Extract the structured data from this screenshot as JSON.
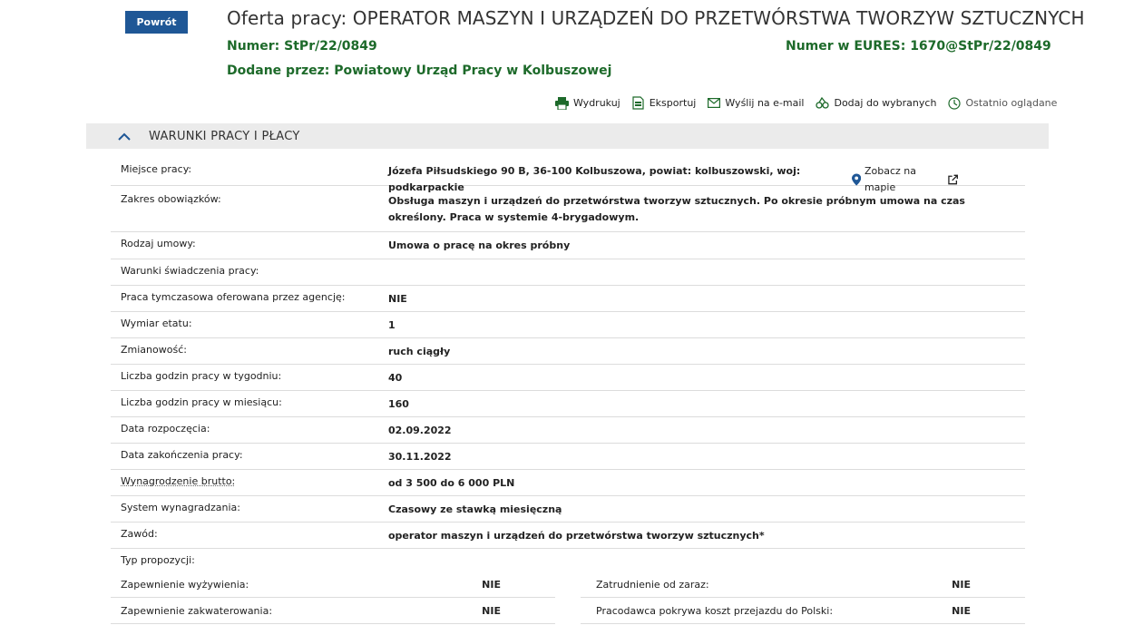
{
  "header": {
    "back_label": "Powrót",
    "title": "Oferta pracy: OPERATOR MASZYN I URZĄDZEŃ DO PRZETWÓRSTWA TWORZYW SZTUCZNYCH",
    "numer_label": "Numer:",
    "numer_value": "StPr/22/0849",
    "eures_label": "Numer w EURES:",
    "eures_value": "1670@StPr/22/0849",
    "dodane_label": "Dodane przez:",
    "dodane_value": "Powiatowy Urząd Pracy w Kolbuszowej"
  },
  "actions": {
    "print": "Wydrukuj",
    "export": "Eksportuj",
    "email": "Wyślij na e-mail",
    "favorite": "Dodaj do wybranych",
    "recent": "Ostatnio oglądane"
  },
  "section": {
    "title": "WARUNKI PRACY I PŁACY",
    "map_link": "Zobacz na mapie",
    "rows": [
      {
        "k": "Miejsce pracy:",
        "v": "Józefa Piłsudskiego 90 B, 36-100 Kolbuszowa, powiat: kolbuszowski, woj: podkarpackie"
      },
      {
        "k": "Zakres obowiązków:",
        "v": "Obsługa maszyn i urządzeń do przetwórstwa tworzyw sztucznych. Po okresie próbnym umowa na czas określony. Praca w systemie 4-brygadowym."
      },
      {
        "k": "Rodzaj umowy:",
        "v": "Umowa o pracę na okres próbny"
      },
      {
        "k": "Warunki świadczenia pracy:",
        "v": ""
      },
      {
        "k": "Praca tymczasowa oferowana przez agencję:",
        "v": "NIE"
      },
      {
        "k": "Wymiar etatu:",
        "v": "1"
      },
      {
        "k": "Zmianowość:",
        "v": "ruch ciągły"
      },
      {
        "k": "Liczba godzin pracy w tygodniu:",
        "v": "40"
      },
      {
        "k": "Liczba godzin pracy w miesiącu:",
        "v": "160"
      },
      {
        "k": "Data rozpoczęcia:",
        "v": "02.09.2022"
      },
      {
        "k": "Data zakończenia pracy:",
        "v": "30.11.2022"
      },
      {
        "k": "Wynagrodzenie brutto:",
        "v": "od 3 500 do 6 000 PLN"
      },
      {
        "k": "System wynagradzania:",
        "v": "Czasowy ze stawką miesięczną"
      },
      {
        "k": "Zawód:",
        "v": "operator maszyn i urządzeń do przetwórstwa tworzyw sztucznych*"
      },
      {
        "k": "Typ propozycji:",
        "v": ""
      }
    ],
    "left_pairs": [
      {
        "k": "Zapewnienie wyżywienia:",
        "v": "NIE"
      },
      {
        "k": "Zapewnienie zakwaterowania:",
        "v": "NIE"
      }
    ],
    "right_pairs": [
      {
        "k": "Zatrudnienie od zaraz:",
        "v": "NIE"
      },
      {
        "k": "Pracodawca pokrywa koszt przejazdu do Polski:",
        "v": "NIE"
      }
    ]
  },
  "colors": {
    "brand_blue": "#1f5796",
    "green": "#1d6a2a",
    "header_bg": "#ebebeb"
  }
}
